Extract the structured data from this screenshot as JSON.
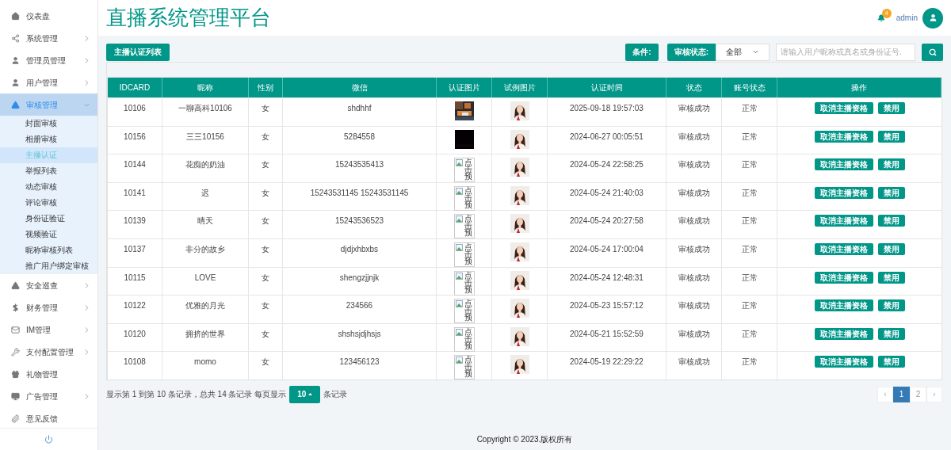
{
  "sidebar": {
    "items": [
      {
        "label": "仪表盘",
        "expandable": false,
        "selected": false
      },
      {
        "label": "系统管理",
        "expandable": true,
        "expanded": false,
        "selected": false
      },
      {
        "label": "管理员管理",
        "expandable": true,
        "expanded": false,
        "selected": false
      },
      {
        "label": "用户管理",
        "expandable": true,
        "expanded": false,
        "selected": false
      },
      {
        "label": "审核管理",
        "expandable": true,
        "expanded": true,
        "selected": true,
        "children": [
          {
            "label": "封面审核",
            "selected": false
          },
          {
            "label": "相册审核",
            "selected": false
          },
          {
            "label": "主播认证",
            "selected": true
          },
          {
            "label": "举报列表",
            "selected": false
          },
          {
            "label": "动态审核",
            "selected": false
          },
          {
            "label": "评论审核",
            "selected": false
          },
          {
            "label": "身份证验证",
            "selected": false
          },
          {
            "label": "视频验证",
            "selected": false
          },
          {
            "label": "昵称审核列表",
            "selected": false
          },
          {
            "label": "推广用户绑定审核",
            "selected": false
          }
        ]
      },
      {
        "label": "安全巡查",
        "expandable": true,
        "expanded": false,
        "selected": false
      },
      {
        "label": "财务管理",
        "expandable": true,
        "expanded": false,
        "selected": false
      },
      {
        "label": "IM管理",
        "expandable": true,
        "expanded": false,
        "selected": false
      },
      {
        "label": "支付配置管理",
        "expandable": true,
        "expanded": false,
        "selected": false
      },
      {
        "label": "礼物管理",
        "expandable": false,
        "selected": false
      },
      {
        "label": "广告管理",
        "expandable": true,
        "expanded": false,
        "selected": false
      },
      {
        "label": "意见反馈",
        "expandable": false,
        "selected": false
      }
    ]
  },
  "header": {
    "title": "直播系统管理平台",
    "notification_count": "4",
    "user": "admin"
  },
  "toolbar": {
    "tab": "主播认证列表",
    "condition_label": "条件:",
    "status_label": "审核状态:",
    "status_value": "全部",
    "search_placeholder": "请输入用户昵称或真名或身份证号."
  },
  "table": {
    "columns": [
      "IDCARD",
      "昵称",
      "性别",
      "微信",
      "认证图片",
      "试例图片",
      "认证时间",
      "状态",
      "账号状态",
      "操作"
    ],
    "rows": [
      {
        "id": "10106",
        "nickname": "一聊高科10106",
        "gender": "女",
        "wechat": "shdhhf",
        "time": "2025-09-18 19:57:03",
        "status": "审核成功",
        "account_status": "正常",
        "actions": [
          "取消主播资格",
          "禁用"
        ]
      },
      {
        "id": "10156",
        "nickname": "三三10156",
        "gender": "女",
        "wechat": "5284558",
        "cert_image": {
          "kind": "dark"
        },
        "time": "2024-06-27 00:05:51",
        "status": "审核成功",
        "account_status": "正常",
        "actions": [
          "取消主播资格",
          "禁用"
        ]
      },
      {
        "id": "10144",
        "nickname": "花痴的奶油",
        "gender": "女",
        "wechat": "15243535413",
        "cert_image": {
          "kind": "broken",
          "alt": "点击预"
        },
        "time": "2024-05-24 22:58:25",
        "status": "审核成功",
        "account_status": "正常",
        "actions": [
          "取消主播资格",
          "禁用"
        ]
      },
      {
        "id": "10141",
        "nickname": "迟",
        "gender": "女",
        "wechat": "15243531145 15243531145",
        "cert_image": {
          "kind": "broken",
          "alt": "点击预"
        },
        "time": "2024-05-24 21:40:03",
        "status": "审核成功",
        "account_status": "正常",
        "actions": [
          "取消主播资格",
          "禁用"
        ]
      },
      {
        "id": "10139",
        "nickname": "晴天",
        "gender": "女",
        "wechat": "15243536523",
        "cert_image": {
          "kind": "broken",
          "alt": "点击预"
        },
        "time": "2024-05-24 20:27:58",
        "status": "审核成功",
        "account_status": "正常",
        "actions": [
          "取消主播资格",
          "禁用"
        ]
      },
      {
        "id": "10137",
        "nickname": "非分的故乡",
        "gender": "女",
        "wechat": "djdjxhbxbs",
        "cert_image": {
          "kind": "broken",
          "alt": "点击预"
        },
        "time": "2024-05-24 17:00:04",
        "status": "审核成功",
        "account_status": "正常",
        "actions": [
          "取消主播资格",
          "禁用"
        ]
      },
      {
        "id": "10115",
        "nickname": "LOVE",
        "gender": "女",
        "wechat": "shengzjjnjk",
        "cert_image": {
          "kind": "broken",
          "alt": "点击预"
        },
        "time": "2024-05-24 12:48:31",
        "status": "审核成功",
        "account_status": "正常",
        "actions": [
          "取消主播资格",
          "禁用"
        ]
      },
      {
        "id": "10122",
        "nickname": "优雅的月光",
        "gender": "女",
        "wechat": "234566",
        "cert_image": {
          "kind": "broken",
          "alt": "点击预"
        },
        "time": "2024-05-23 15:57:12",
        "status": "审核成功",
        "account_status": "正常",
        "actions": [
          "取消主播资格",
          "禁用"
        ]
      },
      {
        "id": "10120",
        "nickname": "拥挤的世界",
        "gender": "女",
        "wechat": "shshsjdjhsjs",
        "cert_image": {
          "kind": "broken",
          "alt": "点击预"
        },
        "time": "2024-05-21 15:52:59",
        "status": "审核成功",
        "account_status": "正常",
        "actions": [
          "取消主播资格",
          "禁用"
        ]
      },
      {
        "id": "10108",
        "nickname": "momo",
        "gender": "女",
        "wechat": "123456123",
        "cert_image": {
          "kind": "broken",
          "alt": "点击预"
        },
        "time": "2024-05-19 22:29:22",
        "status": "审核成功",
        "account_status": "正常",
        "actions": [
          "取消主播资格",
          "禁用"
        ]
      }
    ]
  },
  "footer": {
    "info": "显示第 1 到第 10 条记录，总共 14 条记录 每页显示",
    "page_size": "10",
    "suffix": "条记录",
    "prev": "‹",
    "next": "›",
    "pages": [
      {
        "label": "1",
        "selected": true
      },
      {
        "label": "2",
        "selected": false
      }
    ],
    "copyright": "Copyright © 2023.版权所有"
  }
}
